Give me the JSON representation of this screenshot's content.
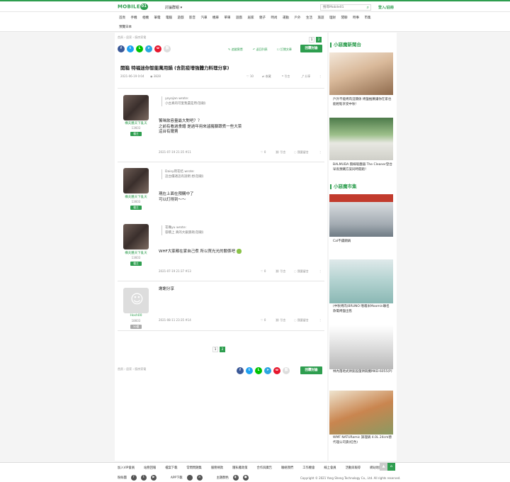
{
  "header": {
    "logo_text": "MOBILE",
    "logo_suffix": "01",
    "forum_menu": "討論群組",
    "search_placeholder": "搜尋Mobile01",
    "login": "登入/註冊"
  },
  "nav": {
    "row1": [
      "首頁",
      "手機",
      "相機",
      "筆電",
      "電腦",
      "遊戲",
      "影音",
      "汽車",
      "機車",
      "單車",
      "遊戲",
      "居家",
      "親子",
      "時尚",
      "運動",
      "戶外",
      "生活",
      "旅遊",
      "理財",
      "閒聊",
      "時事",
      "市集"
    ],
    "row2": [
      "預覽日本"
    ]
  },
  "breadcrumb": "首頁 › 居家 › 廚房家電",
  "pager": [
    "1",
    "2"
  ],
  "share_icons": [
    "facebook-icon",
    "twitter-icon",
    "line-icon",
    "telegram-icon",
    "weibo-icon",
    "link-icon"
  ],
  "actions": {
    "track": "追蹤實價",
    "back_list": "返回列表",
    "bookmark": "訂閱文章",
    "reply": "回覆討論"
  },
  "thread": {
    "title": "開箱 特福迷你智能萬用鍋 (含防疫增強體力料理分享)",
    "date": "2021-06-19 0:04",
    "views": "3828",
    "likes": "10",
    "share": "分享",
    "collect": "收藏",
    "quote": "引言"
  },
  "posts": [
    {
      "user": "構夫醬天下亂天",
      "count": "13603",
      "badge": "樓主",
      "quote_author": "yoyojan wrote:",
      "quote_text": "小台真的可愛我還是用(恕刪)",
      "body": [
        "饕咪飲容量最大對吧？？",
        "之前有看過食譜 是過年用來滷豬腳跟煮一些大菜",
        "這台有爾賣"
      ],
      "time": "2021-07-19 21:35 #11",
      "likes": "0",
      "quote_lbl": "引言",
      "report": "我要留言"
    },
    {
      "user": "構夫醬天下亂天",
      "count": "13603",
      "badge": "樓主",
      "quote_author": "Daisy荷花桔 wrote:",
      "quote_text": "這台價適這有說明 想(恕刪)",
      "body": [
        "現在上面在預購中了",
        "可以訂得到～～"
      ]
    },
    {
      "user": "構夫醬天下亂天",
      "count": "13603",
      "badge": "樓主",
      "quote_author": "花嘴yu wrote:",
      "quote_text": "容積上 真的大銀貨耗(恕刪)",
      "body": [
        "WHF大家都在家自己煮 所以買光光的關係吧"
      ],
      "time": "2021-07-19 21:37 #13",
      "likes": "0",
      "quote_lbl": "引言",
      "report": "我要留言"
    },
    {
      "user": "Hosh00",
      "count": "18603",
      "badge": "30樓",
      "body": [
        "謝謝分享"
      ],
      "time": "2021-08-11 23:35 #14",
      "likes": "0",
      "quote_lbl": "引言",
      "report": "我要留言"
    }
  ],
  "sidebar": {
    "news_head": "小惡魔新聞台",
    "news": [
      "戶外不能烤肉沒關係 烤盤推薦讓你在家也能輕鬆享受中秋！",
      "BALMUDA 無線吸塵器 The Cleaner登台 早鳥預購方案同時開跑！"
    ],
    "market_head": "小惡魔市集",
    "market": [
      "Cal不鏽鋼鍋",
      "(中秋烤肉)BRUNO 嗜嚐米Moomin聯名款電烤盤出售",
      "林內落地式烘氣殺菌烘碗機MKD-6055(P)",
      "WMF NATURamic 調理鍋 4.0L 24cm德代理公司貨(紅色)"
    ]
  },
  "footer": {
    "links": [
      "加入VIP會員",
      "站務回報",
      "檔案下載",
      "常問問題集",
      "服務條款",
      "隱私權政策",
      "合作與廣告",
      "聯絡我們",
      "工作機會",
      "線上會員",
      "活動與報導",
      "網站地圖"
    ],
    "social_label": "粉絲團",
    "app_label": "APP下載",
    "theme_label": "主題顏色",
    "copyright": "Copyright © 2021 Yong Sheng Technology Co., Ltd. All rights reserved."
  }
}
